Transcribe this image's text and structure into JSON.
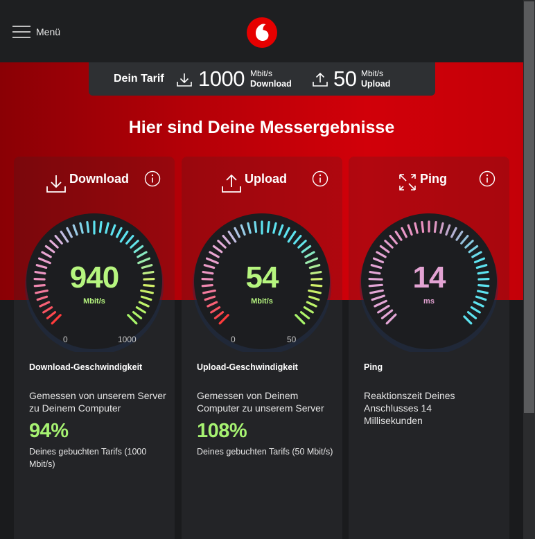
{
  "header": {
    "menu_label": "Menü",
    "logo": "vodafone-logo",
    "brand_color": "#e60000"
  },
  "tarif": {
    "label": "Dein Tarif",
    "download_value": "1000",
    "download_unit": "Mbit/s",
    "download_label": "Download",
    "upload_value": "50",
    "upload_unit": "Mbit/s",
    "upload_label": "Upload"
  },
  "title": "Hier sind Deine Messergebnisse",
  "cards": [
    {
      "title": "Download",
      "icon": "download-icon",
      "value": "940",
      "unit": "Mbit/s",
      "value_color": "#b6f57f",
      "scale_min": "0",
      "scale_max": "1000",
      "gauge_fraction": 0.94,
      "desc_title": "Download-Geschwindigkeit",
      "desc_text": "Gemessen von unserem Server zu Deinem Computer",
      "percent": "94%",
      "percent_text": "Deines gebuchten Tarifs (1000 Mbit/s)"
    },
    {
      "title": "Upload",
      "icon": "upload-icon",
      "value": "54",
      "unit": "Mbit/s",
      "value_color": "#b6f57f",
      "scale_min": "0",
      "scale_max": "50",
      "gauge_fraction": 1.0,
      "desc_title": "Upload-Geschwindigkeit",
      "desc_text": "Gemessen von Deinem Computer zu unserem Server",
      "percent": "108%",
      "percent_text": "Deines gebuchten Tarifs (50 Mbit/s)"
    },
    {
      "title": "Ping",
      "icon": "ping-icon",
      "value": "14",
      "unit": "ms",
      "value_color": "#e3a3d3",
      "desc_title": "Ping",
      "desc_text": "Reaktionszeit Deines Anschlusses 14 Millisekunden"
    }
  ]
}
